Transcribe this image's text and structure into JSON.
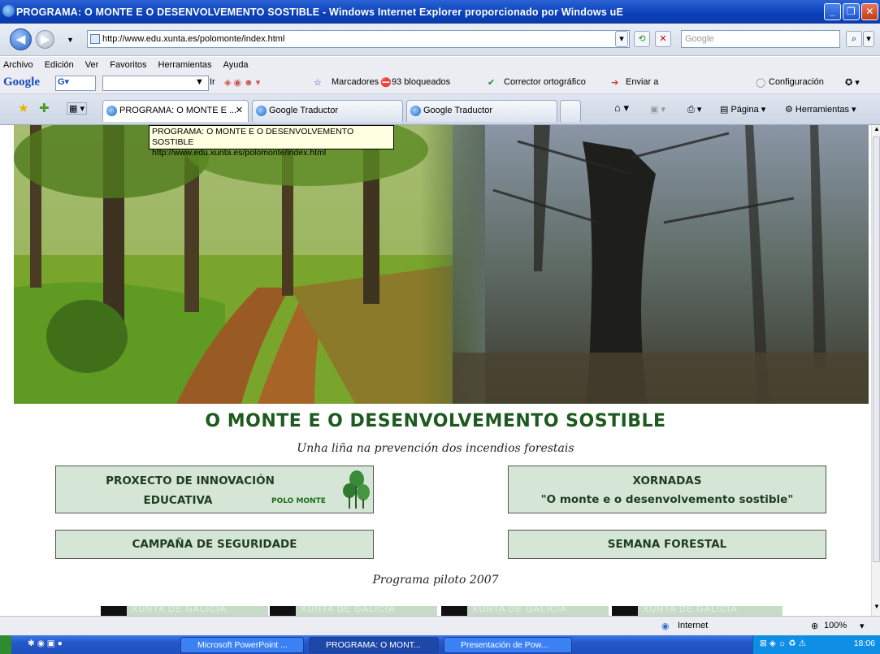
{
  "window": {
    "title": "PROGRAMA: O MONTE E O DESENVOLVEMENTO SOSTIBLE - Windows Internet Explorer proporcionado por Windows uE"
  },
  "address_bar": {
    "url": "http://www.edu.xunta.es/polomonte/index.html",
    "search_placeholder": "Google"
  },
  "menu": [
    "Archivo",
    "Edición",
    "Ver",
    "Favoritos",
    "Herramientas",
    "Ayuda"
  ],
  "google_toolbar": {
    "logo": "Google",
    "go": "Ir",
    "bookmarks": "Marcadores",
    "blocked": "93 bloqueados",
    "spell": "Corrector ortográfico",
    "send": "Enviar a",
    "config": "Configuración"
  },
  "tabs": [
    {
      "label": "PROGRAMA: O MONTE E ..."
    },
    {
      "label": "Google Traductor"
    },
    {
      "label": "Google Traductor"
    }
  ],
  "command_bar": {
    "page": "Página",
    "tools": "Herramientas"
  },
  "tooltip": {
    "line1": "PROGRAMA: O MONTE E O DESENVOLVEMENTO SOSTIBLE",
    "line2": "http://www.edu.xunta.es/polomonte/index.html"
  },
  "page": {
    "title": "O MONTE E O DESENVOLVEMENTO SOSTIBLE",
    "subtitle": "Unha liña na prevención dos incendios forestais",
    "box_innovation_line1": "PROXECTO DE INNOVACIÓN",
    "box_innovation_line2": "EDUCATIVA",
    "box_innovation_logo": "POLO MONTE",
    "box_xornadas_line1": "XORNADAS",
    "box_xornadas_line2": "\"O monte e o desenvolvemento sostible\"",
    "box_campaign": "CAMPAÑA DE SEGURIDADE",
    "box_semana": "SEMANA FORESTAL",
    "pilot": "Programa piloto 2007",
    "xunta": "XUNTA DE GALICIA"
  },
  "status_bar": {
    "zone": "Internet",
    "zoom": "100%"
  },
  "taskbar": {
    "items": [
      "Microsoft PowerPoint ...",
      "PROGRAMA: O MONT...",
      "Presentación de Pow..."
    ],
    "clock": "18:06"
  },
  "colors": {
    "title_green": "#1d5a1f",
    "box_bg": "#d6e6d6",
    "xp_blue": "#2457c8"
  }
}
